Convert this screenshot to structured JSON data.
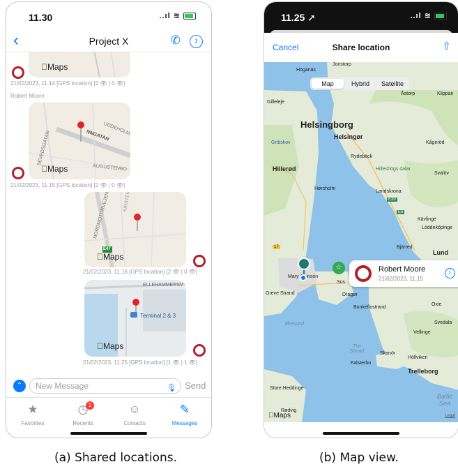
{
  "left_phone": {
    "status": {
      "time": "11.30",
      "icons": "..ıl ≋"
    },
    "nav": {
      "back": "‹",
      "title": "Project X",
      "phone_icon": "✆",
      "info_icon": "i"
    },
    "messages": [
      {
        "maps_label": "Maps",
        "meta": "21/02/2023, 11.14 [GPS location] [2 👁 | 0 👁]"
      },
      {
        "sender": "Robert Moore",
        "maps_label": "Maps",
        "meta": "21/02/2023, 11.15 [GPS location] [2 👁 | 0 👁]",
        "streets": [
          "UDDEHOLMSG",
          "AUGUSTENBO",
          "SEVEDSGATAN",
          "NNGATAN"
        ]
      },
      {
        "maps_label": "Maps",
        "meta": "21/02/2023, 11.16 [GPS location] [2 👁 | 0 👁]",
        "streets": [
          "NORDMOTORVEJEN",
          "KIRSTEN"
        ],
        "road_sign": "E47"
      },
      {
        "maps_label": "Maps",
        "meta": "21/02/2023, 11.25 [GPS location] [1 👁 | 1 👁]",
        "streets": [
          "ELLEHAMMERSV"
        ],
        "poi": "Terminal 2 & 3"
      }
    ],
    "input": {
      "up_icon": "⌃",
      "placeholder": "New Message",
      "mic_icon": "🎙",
      "send": "Send"
    },
    "tabs": [
      {
        "label": "Favorites",
        "icon": "★"
      },
      {
        "label": "Recents",
        "icon": "◷",
        "badge": "1"
      },
      {
        "label": "Contacts",
        "icon": "☺"
      },
      {
        "label": "Messages",
        "icon": "✎"
      }
    ],
    "caption": "(a) Shared locations."
  },
  "right_phone": {
    "status": {
      "time": "11.25 ➚",
      "icons": "..ıl ≋"
    },
    "sheet": {
      "cancel": "Cancel",
      "title": "Share location",
      "share_icon": "⇧"
    },
    "map_types": [
      "Map",
      "Hybrid",
      "Satellite"
    ],
    "selected_map_type": "Map",
    "places": {
      "hoganas": "Höganäs",
      "jonstorp": "Jonstorp",
      "astorp": "Åstorp",
      "klippan": "Klippan",
      "gilleleje": "Gilleleje",
      "helsingborg": "Helsingborg",
      "helsingor": "Helsingør",
      "gribskov": "Gribskov",
      "kagerod": "Kågeröd",
      "rydeback": "Rydebäck",
      "hillerod": "Hillerød",
      "hilleshog": "Hilleshögs dalar",
      "svalov": "Svalöv",
      "horsholm": "Hørsholm",
      "landskrona": "Landskrona",
      "kavlinge": "Kävlinge",
      "loddekopinge": "Löddeköpinge",
      "bjarred": "Bjärred",
      "lund": "Lund",
      "copenhagen": "Mary Chinson",
      "sus": "Sus",
      "dragor": "Dragør",
      "greve": "Greve Strand",
      "bunkeflo": "Bunkeflostrand",
      "oxie": "Oxie",
      "oresund": "Øresund",
      "vellinge": "Vellinge",
      "svedala": "Svedala",
      "sound": "The Sound",
      "skanor": "Skanör",
      "hollviken": "Höllviken",
      "falsterbo": "Falsterbo",
      "trelleborg": "Trelleborg",
      "storeh": "Store Heddinge",
      "redvig": "Rødvig",
      "baltic": "Baltic Sea",
      "road_e20": "E20",
      "road_e6": "E6",
      "road_17": "17"
    },
    "callout": {
      "name": "Robert Moore",
      "date": "21/02/2023, 11.15",
      "info_icon": "i"
    },
    "maps_logo": "Maps",
    "legal": "Legal",
    "caption": "(b) Map view."
  }
}
